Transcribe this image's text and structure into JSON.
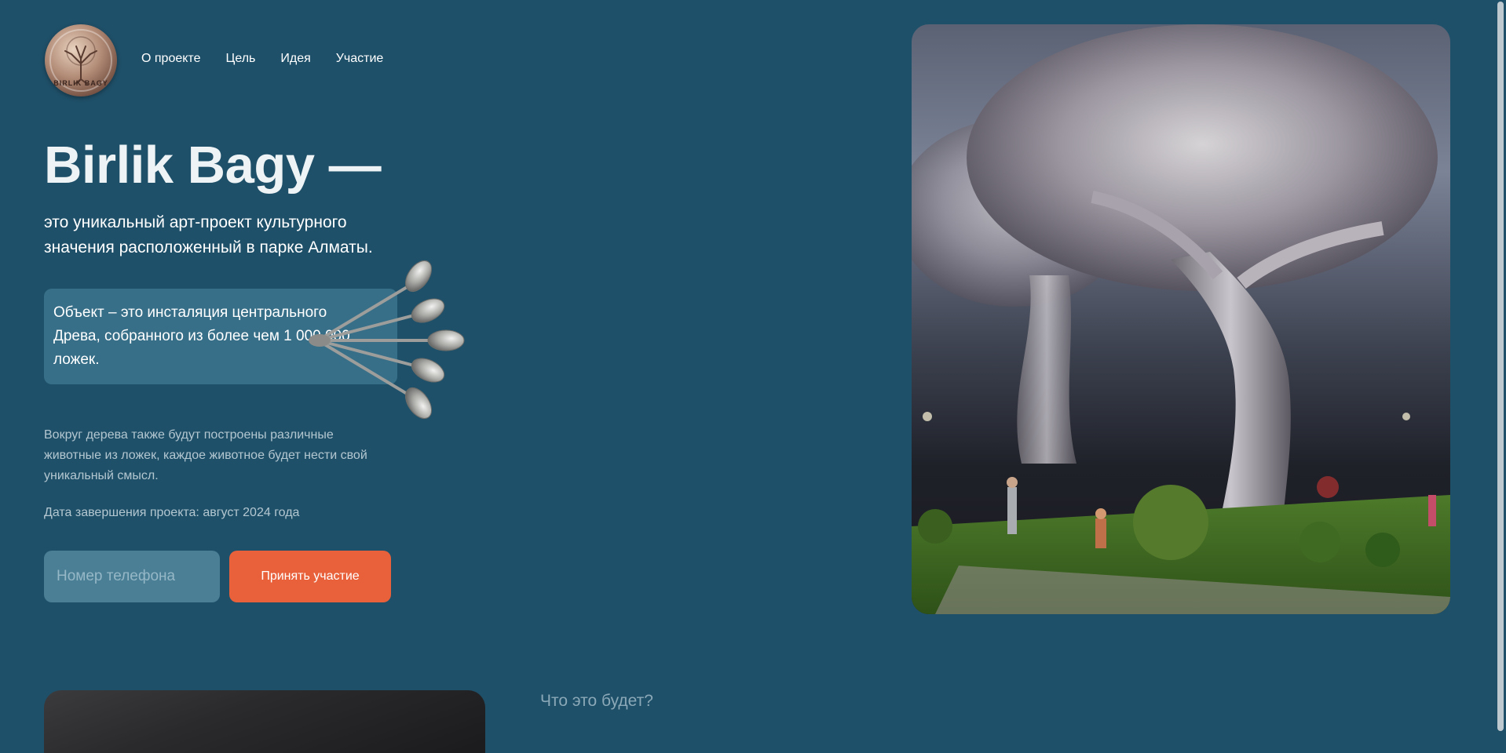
{
  "logo": {
    "text": "BIRLIK BAGY"
  },
  "nav": {
    "items": [
      {
        "label": "О проекте"
      },
      {
        "label": "Цель"
      },
      {
        "label": "Идея"
      },
      {
        "label": "Участие"
      }
    ]
  },
  "hero": {
    "title": "Birlik Bagy —",
    "subtitle": "это уникальный арт-проект культурного значения расположенный в парке Алматы.",
    "callout": "Объект – это инсталяция центрального Древа, собранного из более чем 1 000 000 ложек.",
    "description": "Вокруг дерева также будут построены различные животные из ложек, каждое животное будет нести свой уникальный смысл.",
    "date": "Дата завершения проекта: август 2024 года",
    "phone_placeholder": "Номер телефона",
    "phone_value": "",
    "cta_label": "Принять участие"
  },
  "section2": {
    "title": "Что это будет?"
  },
  "colors": {
    "background": "#1f5069",
    "callout": "#386f88",
    "input": "#4a7f96",
    "cta": "#e8613b",
    "muted_text": "#b3c7d1"
  }
}
